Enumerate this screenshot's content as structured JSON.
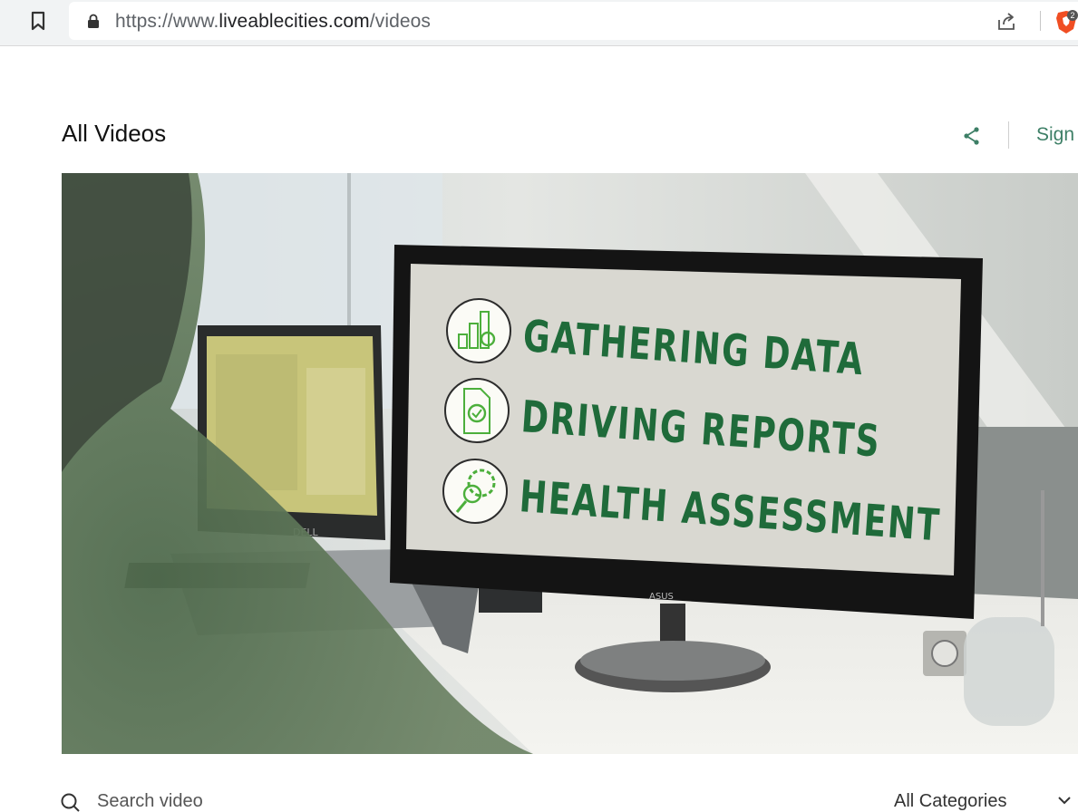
{
  "browser": {
    "url_prefix": "https://www.",
    "url_domain": "liveablecities.com",
    "url_path": "/videos",
    "brave_badge": "2"
  },
  "page": {
    "title": "All Videos",
    "signin_label": "Sign"
  },
  "video": {
    "screen_lines": [
      "GATHERING DATA",
      "DRIVING REPORTS",
      "HEALTH ASSESSMENT"
    ],
    "laptop_brand": "DELL",
    "monitor_brand": "ASUS"
  },
  "search": {
    "placeholder": "Search video",
    "category_selected": "All Categories"
  },
  "colors": {
    "accent": "#3d7f66",
    "screen_text": "#1f6b3a",
    "icon_green": "#4caf3c"
  }
}
